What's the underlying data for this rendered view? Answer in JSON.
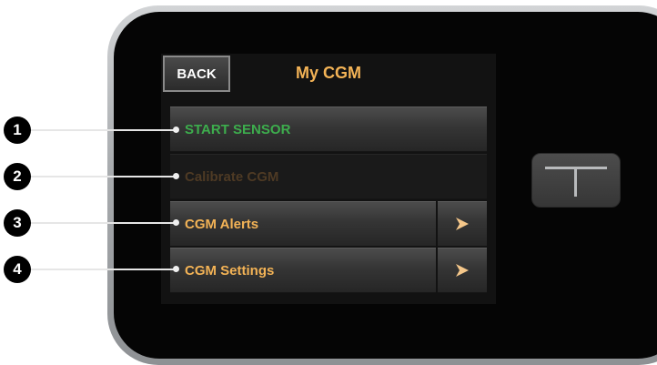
{
  "header": {
    "back_label": "BACK",
    "title": "My CGM"
  },
  "menu": {
    "items": [
      {
        "label": "START SENSOR",
        "color": "#3dad4d",
        "has_arrow": false,
        "enabled": true
      },
      {
        "label": "Calibrate CGM",
        "color": "#4e3a24",
        "has_arrow": false,
        "enabled": false
      },
      {
        "label": "CGM Alerts",
        "color": "#f3b356",
        "has_arrow": true,
        "enabled": true
      },
      {
        "label": "CGM Settings",
        "color": "#f3b356",
        "has_arrow": true,
        "enabled": true
      }
    ]
  },
  "callouts": [
    "1",
    "2",
    "3",
    "4"
  ],
  "icons": {
    "arrow": "right-arrow-icon",
    "device_button": "t-logo-icon"
  },
  "colors": {
    "title": "#f3b356",
    "start_sensor": "#3dad4d",
    "disabled": "#4e3a24",
    "arrow": "#f5c78a"
  }
}
